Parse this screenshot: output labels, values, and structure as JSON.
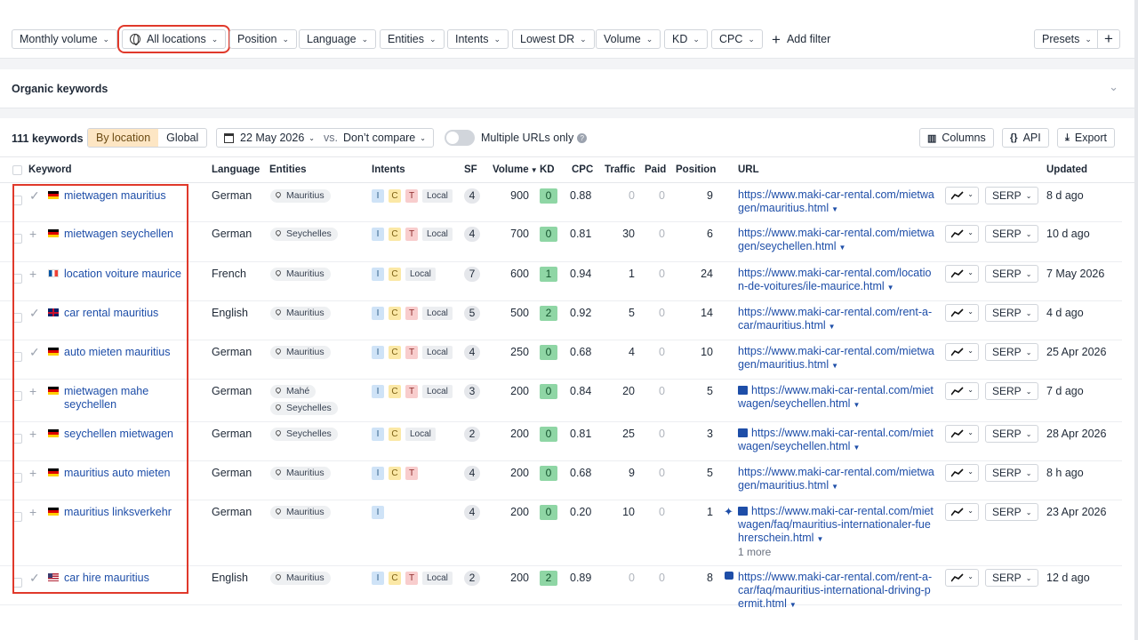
{
  "filters": [
    {
      "label": "Monthly volume"
    },
    {
      "label": "All locations"
    },
    {
      "label": "Position"
    },
    {
      "label": "Language"
    },
    {
      "label": "Entities"
    },
    {
      "label": "Intents"
    },
    {
      "label": "Lowest DR"
    },
    {
      "label": "Volume"
    },
    {
      "label": "KD"
    },
    {
      "label": "CPC"
    }
  ],
  "add_filter": "Add filter",
  "presets": "Presets",
  "organic_title": "Organic keywords",
  "toolbar": {
    "count": "111 keywords",
    "by_location": "By location",
    "global": "Global",
    "date": "22 May 2026",
    "vs": "vs.",
    "compare": "Don’t compare",
    "multiple_urls": "Multiple URLs only",
    "columns": "Columns",
    "api": "API",
    "export": "Export"
  },
  "columns": {
    "keyword": "Keyword",
    "language": "Language",
    "entities": "Entities",
    "intents": "Intents",
    "sf": "SF",
    "volume": "Volume",
    "kd": "KD",
    "cpc": "CPC",
    "traffic": "Traffic",
    "paid": "Paid",
    "position": "Position",
    "url": "URL",
    "updated": "Updated"
  },
  "rows": [
    {
      "mark": "✓",
      "flag": "de",
      "keyword": "mietwagen mauritius",
      "language": "German",
      "entities": [
        "Mauritius"
      ],
      "intents": [
        "I",
        "C",
        "T",
        "Local"
      ],
      "sf": "4",
      "volume": "900",
      "kd": "0",
      "cpc": "0.88",
      "traffic": "0",
      "paid": "0",
      "position": "9",
      "url": "https://www.maki-car-rental.com/mietwagen/mauritius.html",
      "url_prefix": "",
      "more": "",
      "serp": "SERP",
      "updated": "8 d ago"
    },
    {
      "mark": "+",
      "flag": "de",
      "keyword": "mietwagen seychellen",
      "language": "German",
      "entities": [
        "Seychelles"
      ],
      "intents": [
        "I",
        "C",
        "T",
        "Local"
      ],
      "sf": "4",
      "volume": "700",
      "kd": "0",
      "cpc": "0.81",
      "traffic": "30",
      "paid": "0",
      "position": "6",
      "url": "https://www.maki-car-rental.com/mietwagen/seychellen.html",
      "url_prefix": "",
      "more": "",
      "serp": "SERP",
      "updated": "10 d ago"
    },
    {
      "mark": "+",
      "flag": "fr",
      "keyword": "location voiture maurice",
      "language": "French",
      "entities": [
        "Mauritius"
      ],
      "intents": [
        "I",
        "C",
        "Local"
      ],
      "sf": "7",
      "volume": "600",
      "kd": "1",
      "cpc": "0.94",
      "traffic": "1",
      "paid": "0",
      "position": "24",
      "url": "https://www.maki-car-rental.com/location-de-voitures/ile-maurice.html",
      "url_prefix": "",
      "more": "",
      "serp": "SERP",
      "updated": "7 May 2026"
    },
    {
      "mark": "✓",
      "flag": "uk",
      "keyword": "car rental mauritius",
      "language": "English",
      "entities": [
        "Mauritius"
      ],
      "intents": [
        "I",
        "C",
        "T",
        "Local"
      ],
      "sf": "5",
      "volume": "500",
      "kd": "2",
      "cpc": "0.92",
      "traffic": "5",
      "paid": "0",
      "position": "14",
      "url": "https://www.maki-car-rental.com/rent-a-car/mauritius.html",
      "url_prefix": "",
      "more": "",
      "serp": "SERP",
      "updated": "4 d ago"
    },
    {
      "mark": "✓",
      "flag": "de",
      "keyword": "auto mieten mauritius",
      "language": "German",
      "entities": [
        "Mauritius"
      ],
      "intents": [
        "I",
        "C",
        "T",
        "Local"
      ],
      "sf": "4",
      "volume": "250",
      "kd": "0",
      "cpc": "0.68",
      "traffic": "4",
      "paid": "0",
      "position": "10",
      "url": "https://www.maki-car-rental.com/mietwagen/mauritius.html",
      "url_prefix": "",
      "more": "",
      "serp": "SERP",
      "updated": "25 Apr 2026"
    },
    {
      "mark": "+",
      "flag": "de",
      "keyword": "mietwagen mahe seychellen",
      "language": "German",
      "entities": [
        "Mahé",
        "Seychelles"
      ],
      "intents": [
        "I",
        "C",
        "T",
        "Local"
      ],
      "sf": "3",
      "volume": "200",
      "kd": "0",
      "cpc": "0.84",
      "traffic": "20",
      "paid": "0",
      "position": "5",
      "url": "https://www.maki-car-rental.com/mietwagen/seychellen.html",
      "url_prefix": "img",
      "more": "",
      "serp": "SERP",
      "updated": "7 d ago"
    },
    {
      "mark": "+",
      "flag": "de",
      "keyword": "seychellen mietwagen",
      "language": "German",
      "entities": [
        "Seychelles"
      ],
      "intents": [
        "I",
        "C",
        "Local"
      ],
      "sf": "2",
      "volume": "200",
      "kd": "0",
      "cpc": "0.81",
      "traffic": "25",
      "paid": "0",
      "position": "3",
      "url": "https://www.maki-car-rental.com/mietwagen/seychellen.html",
      "url_prefix": "img",
      "more": "",
      "serp": "SERP",
      "updated": "28 Apr 2026"
    },
    {
      "mark": "+",
      "flag": "de",
      "keyword": "mauritius auto mieten",
      "language": "German",
      "entities": [
        "Mauritius"
      ],
      "intents": [
        "I",
        "C",
        "T"
      ],
      "sf": "4",
      "volume": "200",
      "kd": "0",
      "cpc": "0.68",
      "traffic": "9",
      "paid": "0",
      "position": "5",
      "url": "https://www.maki-car-rental.com/mietwagen/mauritius.html",
      "url_prefix": "",
      "more": "",
      "serp": "SERP",
      "updated": "8 h ago"
    },
    {
      "mark": "+",
      "flag": "de",
      "keyword": "mauritius linksverkehr",
      "language": "German",
      "entities": [
        "Mauritius"
      ],
      "intents": [
        "I"
      ],
      "sf": "4",
      "volume": "200",
      "kd": "0",
      "cpc": "0.20",
      "traffic": "10",
      "paid": "0",
      "position": "1",
      "url": "https://www.maki-car-rental.com/mietwagen/faq/mauritius-internationaler-fuehrerschein.html",
      "url_prefix": "spark+img",
      "more": "1 more",
      "serp": "SERP",
      "updated": "23 Apr 2026"
    },
    {
      "mark": "✓",
      "flag": "us",
      "keyword": "car hire mauritius",
      "language": "English",
      "entities": [
        "Mauritius"
      ],
      "intents": [
        "I",
        "C",
        "T",
        "Local"
      ],
      "sf": "2",
      "volume": "200",
      "kd": "2",
      "cpc": "0.89",
      "traffic": "0",
      "paid": "0",
      "position": "8",
      "url": "https://www.maki-car-rental.com/rent-a-car/faq/mauritius-international-driving-permit.html",
      "url_prefix": "chat",
      "more": "",
      "serp": "SERP",
      "updated": "12 d ago"
    }
  ]
}
